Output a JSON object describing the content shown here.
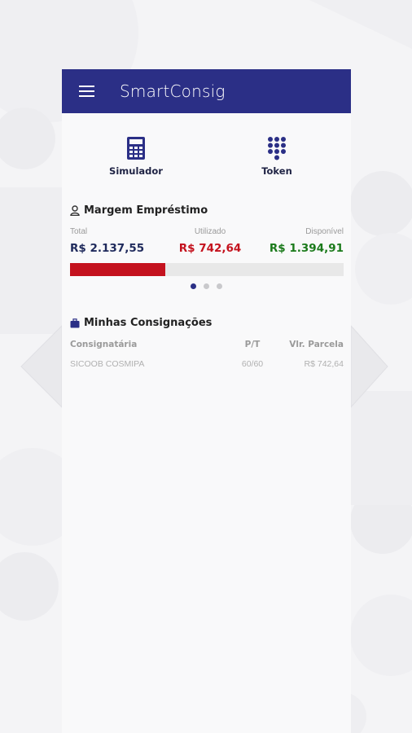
{
  "app": {
    "title": "SmartConsig"
  },
  "shortcuts": [
    {
      "label": "Simulador",
      "icon": "calculator-icon"
    },
    {
      "label": "Token",
      "icon": "keypad-icon"
    }
  ],
  "margem": {
    "title": "Margem Empréstimo",
    "labels": {
      "total": "Total",
      "utilizado": "Utilizado",
      "disponivel": "Disponível"
    },
    "values": {
      "total": "R$ 2.137,55",
      "utilizado": "R$ 742,64",
      "disponivel": "R$ 1.394,91"
    },
    "used_fraction": 0.347,
    "pager": {
      "pages": 3,
      "active": 1
    }
  },
  "consignacoes": {
    "title": "Minhas Consignações",
    "columns": [
      "Consignatária",
      "P/T",
      "Vlr. Parcela"
    ],
    "rows": [
      [
        "SICOOB COSMIPA",
        "60/60",
        "R$ 742,64"
      ]
    ]
  },
  "colors": {
    "primary": "#2b2f86",
    "used": "#c4121e",
    "available": "#1b7a1b",
    "total": "#1f2a5c"
  }
}
